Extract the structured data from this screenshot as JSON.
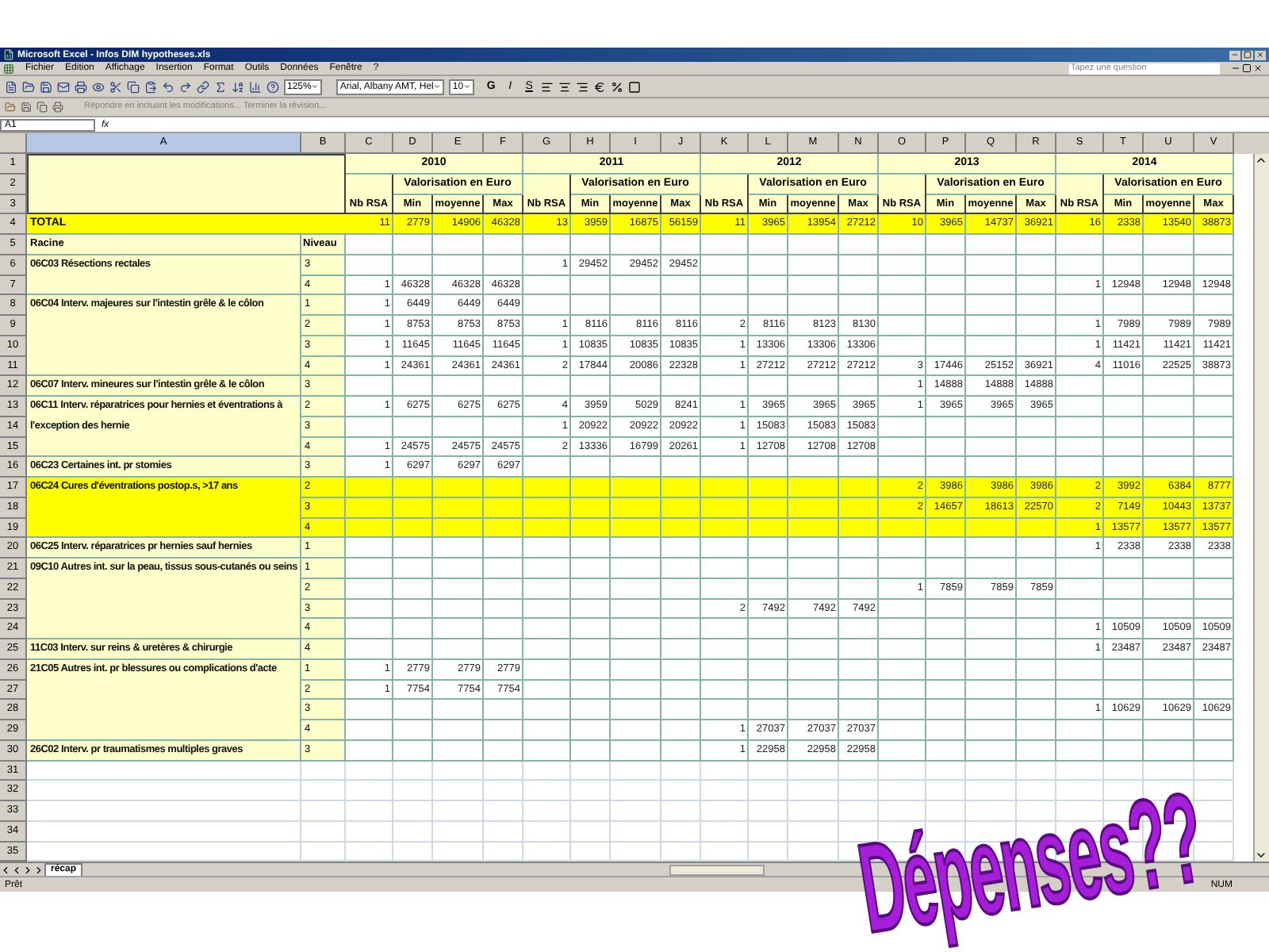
{
  "window": {
    "title": "Microsoft Excel - Infos DIM hypotheses.xls"
  },
  "menu": [
    "Fichier",
    "Edition",
    "Affichage",
    "Insertion",
    "Format",
    "Outils",
    "Données",
    "Fenêtre",
    "?"
  ],
  "help_box": {
    "placeholder": "Tapez une question"
  },
  "toolbar": {
    "zoom": "125%",
    "font": "Arial, Albany AMT, Hel",
    "font_size": "10",
    "format_letters": [
      "G",
      "I",
      "S"
    ]
  },
  "review_toolbar": {
    "text": "Répondre en incluant les modifications... Terminer la révision..."
  },
  "formula_bar": {
    "name_box": "A1",
    "fx": "fx"
  },
  "columns": [
    "A",
    "B",
    "C",
    "D",
    "E",
    "F",
    "G",
    "H",
    "I",
    "J",
    "K",
    "L",
    "M",
    "N",
    "O",
    "P",
    "Q",
    "R",
    "S",
    "T",
    "U",
    "V"
  ],
  "row_numbers": [
    "1",
    "2",
    "3",
    "4",
    "5",
    "6",
    "7",
    "8",
    "9",
    "10",
    "11",
    "12",
    "13",
    "14",
    "15",
    "16",
    "17",
    "18",
    "19",
    "20",
    "21",
    "22",
    "23",
    "24",
    "25",
    "26",
    "27",
    "28",
    "29",
    "30",
    "31",
    "32",
    "33",
    "34",
    "35"
  ],
  "years": [
    {
      "year": "2010",
      "group": "Valorisation en Euro",
      "columns": [
        "Nb RSA",
        "Min",
        "moyenne",
        "Max"
      ]
    },
    {
      "year": "2011",
      "group": "Valorisation en Euro",
      "columns": [
        "Nb RSA",
        "Min",
        "moyenne",
        "Max"
      ]
    },
    {
      "year": "2012",
      "group": "Valorisation en Euro",
      "columns": [
        "Nb RSA",
        "Min",
        "moyenne",
        "Max"
      ]
    },
    {
      "year": "2013",
      "group": "Valorisation en Euro",
      "columns": [
        "Nb RSA",
        "Min",
        "moyenne",
        "Max"
      ]
    },
    {
      "year": "2014",
      "group": "Valorisation en Euro",
      "columns": [
        "Nb RSA",
        "Min",
        "moyenne",
        "Max"
      ]
    }
  ],
  "total": {
    "label": "TOTAL",
    "highlighted": true,
    "cells": [
      [
        "11",
        "2779",
        "14906",
        "46328"
      ],
      [
        "13",
        "3959",
        "16875",
        "56159"
      ],
      [
        "11",
        "3965",
        "13954",
        "27212"
      ],
      [
        "10",
        "3965",
        "14737",
        "36921"
      ],
      [
        "16",
        "2338",
        "13540",
        "38873"
      ]
    ]
  },
  "list_header": {
    "label": "Racine",
    "niveau": "Niveau"
  },
  "groups": [
    {
      "label": "06C03 Résections rectales",
      "highlighted": false,
      "levels": [
        {
          "niveau": "3",
          "cells": [
            null,
            [
              "1",
              "29452",
              "29452",
              "29452"
            ],
            null,
            null,
            null
          ]
        },
        {
          "niveau": "4",
          "cells": [
            [
              "1",
              "46328",
              "46328",
              "46328"
            ],
            null,
            null,
            null,
            [
              "1",
              "12948",
              "12948",
              "12948"
            ]
          ]
        }
      ]
    },
    {
      "label": "06C04 Interv. majeures sur l'intestin grêle & le côlon",
      "highlighted": false,
      "levels": [
        {
          "niveau": "1",
          "cells": [
            [
              "1",
              "6449",
              "6449",
              "6449"
            ],
            null,
            null,
            null,
            null
          ]
        },
        {
          "niveau": "2",
          "cells": [
            [
              "1",
              "8753",
              "8753",
              "8753"
            ],
            [
              "1",
              "8116",
              "8116",
              "8116"
            ],
            [
              "2",
              "8116",
              "8123",
              "8130"
            ],
            null,
            [
              "1",
              "7989",
              "7989",
              "7989"
            ]
          ]
        },
        {
          "niveau": "3",
          "cells": [
            [
              "1",
              "11645",
              "11645",
              "11645"
            ],
            [
              "1",
              "10835",
              "10835",
              "10835"
            ],
            [
              "1",
              "13306",
              "13306",
              "13306"
            ],
            null,
            [
              "1",
              "11421",
              "11421",
              "11421"
            ]
          ]
        },
        {
          "niveau": "4",
          "cells": [
            [
              "1",
              "24361",
              "24361",
              "24361"
            ],
            [
              "2",
              "17844",
              "20086",
              "22328"
            ],
            [
              "1",
              "27212",
              "27212",
              "27212"
            ],
            [
              "3",
              "17446",
              "25152",
              "36921"
            ],
            [
              "4",
              "11016",
              "22525",
              "38873"
            ]
          ]
        }
      ]
    },
    {
      "label": "06C07 Interv. mineures sur l'intestin grêle & le côlon",
      "highlighted": false,
      "levels": [
        {
          "niveau": "3",
          "cells": [
            null,
            null,
            null,
            [
              "1",
              "14888",
              "14888",
              "14888"
            ],
            null
          ]
        }
      ]
    },
    {
      "label": "06C11 Interv. réparatrices pour hernies et éventrations à l'exception des hernie",
      "highlighted": false,
      "levels": [
        {
          "niveau": "2",
          "cells": [
            [
              "1",
              "6275",
              "6275",
              "6275"
            ],
            [
              "4",
              "3959",
              "5029",
              "8241"
            ],
            [
              "1",
              "3965",
              "3965",
              "3965"
            ],
            [
              "1",
              "3965",
              "3965",
              "3965"
            ],
            null
          ]
        },
        {
          "niveau": "3",
          "cells": [
            null,
            [
              "1",
              "20922",
              "20922",
              "20922"
            ],
            [
              "1",
              "15083",
              "15083",
              "15083"
            ],
            null,
            null
          ]
        },
        {
          "niveau": "4",
          "cells": [
            [
              "1",
              "24575",
              "24575",
              "24575"
            ],
            [
              "2",
              "13336",
              "16799",
              "20261"
            ],
            [
              "1",
              "12708",
              "12708",
              "12708"
            ],
            null,
            null
          ]
        }
      ]
    },
    {
      "label": "06C23 Certaines int. pr stomies",
      "highlighted": false,
      "levels": [
        {
          "niveau": "3",
          "cells": [
            [
              "1",
              "6297",
              "6297",
              "6297"
            ],
            null,
            null,
            null,
            null
          ]
        }
      ]
    },
    {
      "label": "06C24 Cures d'éventrations postop.s, >17 ans",
      "highlighted": true,
      "levels": [
        {
          "niveau": "2",
          "cells": [
            null,
            null,
            null,
            [
              "2",
              "3986",
              "3986",
              "3986"
            ],
            [
              "2",
              "3992",
              "6384",
              "8777"
            ]
          ]
        },
        {
          "niveau": "3",
          "cells": [
            null,
            null,
            null,
            [
              "2",
              "14657",
              "18613",
              "22570"
            ],
            [
              "2",
              "7149",
              "10443",
              "13737"
            ]
          ]
        },
        {
          "niveau": "4",
          "cells": [
            null,
            null,
            null,
            null,
            [
              "1",
              "13577",
              "13577",
              "13577"
            ]
          ]
        }
      ]
    },
    {
      "label": "06C25 Interv. réparatrices pr hernies sauf hernies",
      "highlighted": false,
      "levels": [
        {
          "niveau": "1",
          "cells": [
            null,
            null,
            null,
            null,
            [
              "1",
              "2338",
              "2338",
              "2338"
            ]
          ]
        }
      ]
    },
    {
      "label": "09C10 Autres int. sur la peau, tissus sous-cutanés ou seins",
      "highlighted": false,
      "levels": [
        {
          "niveau": "1",
          "cells": [
            null,
            null,
            null,
            null,
            null
          ]
        },
        {
          "niveau": "2",
          "cells": [
            null,
            null,
            null,
            [
              "1",
              "7859",
              "7859",
              "7859"
            ],
            null
          ]
        },
        {
          "niveau": "3",
          "cells": [
            null,
            null,
            [
              "2",
              "7492",
              "7492",
              "7492"
            ],
            null,
            null
          ]
        },
        {
          "niveau": "4",
          "cells": [
            null,
            null,
            null,
            null,
            [
              "1",
              "10509",
              "10509",
              "10509"
            ]
          ]
        }
      ]
    },
    {
      "label": "11C03 Interv. sur reins & uretères & chirurgie",
      "highlighted": false,
      "levels": [
        {
          "niveau": "4",
          "cells": [
            null,
            null,
            null,
            null,
            [
              "1",
              "23487",
              "23487",
              "23487"
            ]
          ]
        }
      ]
    },
    {
      "label": "21C05 Autres int. pr blessures ou complications d'acte",
      "highlighted": false,
      "levels": [
        {
          "niveau": "1",
          "cells": [
            [
              "1",
              "2779",
              "2779",
              "2779"
            ],
            null,
            null,
            null,
            null
          ]
        },
        {
          "niveau": "2",
          "cells": [
            [
              "1",
              "7754",
              "7754",
              "7754"
            ],
            null,
            null,
            null,
            null
          ]
        },
        {
          "niveau": "3",
          "cells": [
            null,
            null,
            null,
            null,
            [
              "1",
              "10629",
              "10629",
              "10629"
            ]
          ]
        },
        {
          "niveau": "4",
          "cells": [
            null,
            null,
            [
              "1",
              "27037",
              "27037",
              "27037"
            ],
            null,
            null
          ]
        }
      ]
    },
    {
      "label": "26C02 Interv. pr traumatismes multiples graves",
      "highlighted": false,
      "levels": [
        {
          "niveau": "3",
          "cells": [
            null,
            null,
            [
              "1",
              "22958",
              "22958",
              "22958"
            ],
            null,
            null
          ]
        }
      ]
    }
  ],
  "sheet_tabs": [
    {
      "label": "récap",
      "selected": true
    }
  ],
  "status_bar": {
    "left": "Prêt",
    "right": "NUM"
  },
  "overlay_text": "Dépenses??"
}
